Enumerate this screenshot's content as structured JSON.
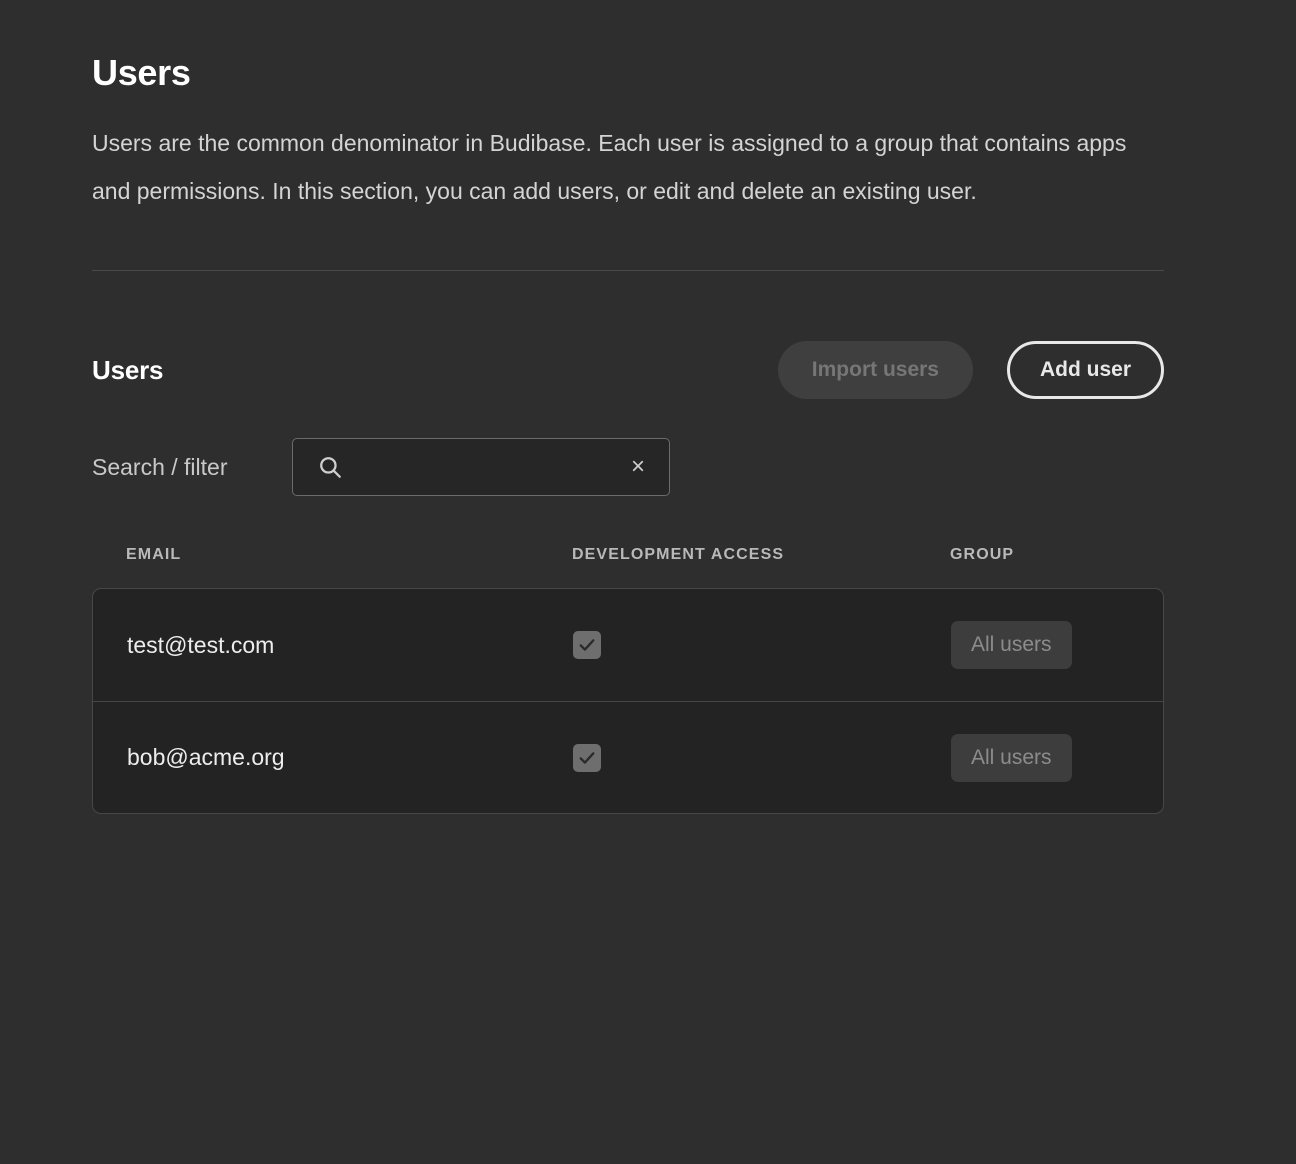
{
  "header": {
    "title": "Users",
    "description": "Users are the common denominator in Budibase. Each user is assigned to a group that contains apps and permissions. In this section, you can add users, or edit and delete an existing user."
  },
  "section": {
    "title": "Users",
    "import_label": "Import users",
    "add_label": "Add user"
  },
  "search": {
    "label": "Search / filter",
    "value": "",
    "placeholder": "",
    "search_icon": "search-icon",
    "clear_icon": "close-icon",
    "clear_glyph": "×"
  },
  "table": {
    "columns": [
      {
        "key": "email",
        "label": "EMAIL"
      },
      {
        "key": "access",
        "label": "DEVELOPMENT ACCESS"
      },
      {
        "key": "group",
        "label": "GROUP"
      }
    ],
    "rows": [
      {
        "email": "test@test.com",
        "access_checked": true,
        "group": "All users"
      },
      {
        "email": "bob@acme.org",
        "access_checked": true,
        "group": "All users"
      }
    ]
  },
  "colors": {
    "page_background": "#2e2e2e",
    "row_background": "#232323",
    "border": "#474747",
    "divider": "#4a4a4a",
    "text_primary": "#ffffff",
    "text_secondary": "#d4d4d4",
    "text_muted": "#8c8c8c",
    "secondary_button_fill": "#3f3f3f",
    "secondary_button_text": "#767676",
    "checkbox_fill": "#6e6e6e",
    "badge_fill": "#3d3d3d"
  }
}
